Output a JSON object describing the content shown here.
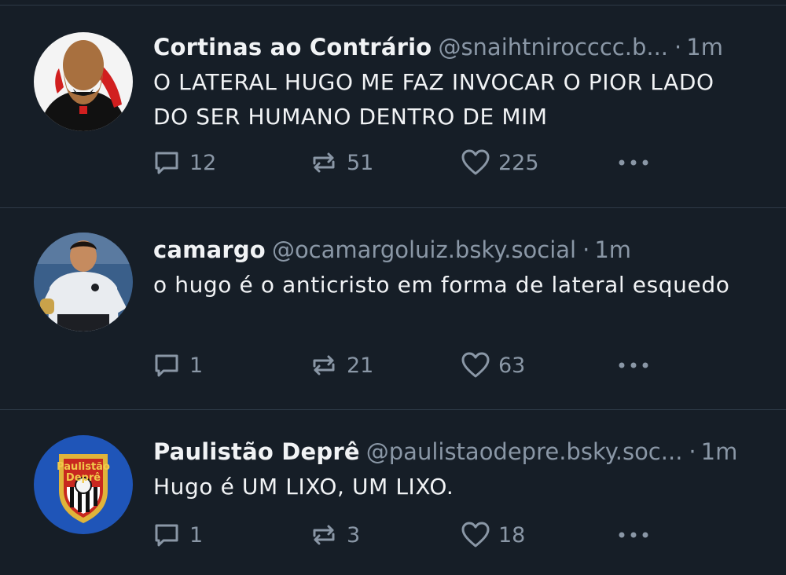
{
  "posts": [
    {
      "author_name": "Cortinas ao Contrário",
      "handle": "@snaihtnirocccc.b...",
      "separator": "·",
      "time": "1m",
      "text": "O LATERAL HUGO ME FAZ INVOCAR O PIOR LADO DO SER HUMANO DENTRO DE MIM",
      "replies": "12",
      "reposts": "51",
      "likes": "225",
      "avatar_icon": "avatar-man-red-black-jacket"
    },
    {
      "author_name": "camargo",
      "handle": "@ocamargoluiz.bsky.social",
      "separator": "·",
      "time": "1m",
      "text": "o hugo é o anticristo em forma de lateral esquedo",
      "replies": "1",
      "reposts": "21",
      "likes": "63",
      "avatar_icon": "avatar-player-white-jersey"
    },
    {
      "author_name": "Paulistão Deprê",
      "handle": "@paulistaodepre.bsky.soc...",
      "separator": "·",
      "time": "1m",
      "text": "Hugo é UM LIXO, UM LIXO.",
      "replies": "1",
      "reposts": "3",
      "likes": "18",
      "avatar_icon": "avatar-shield-crest",
      "avatar_text": [
        "Paulistão",
        "Deprê"
      ]
    }
  ],
  "icons": {
    "reply": "reply-icon",
    "repost": "repost-icon",
    "like": "heart-icon",
    "more": "more-options-icon"
  },
  "colors": {
    "background": "#161e27",
    "text": "#f1f3f5",
    "muted": "#8a97a6",
    "divider": "#2e3a47"
  }
}
